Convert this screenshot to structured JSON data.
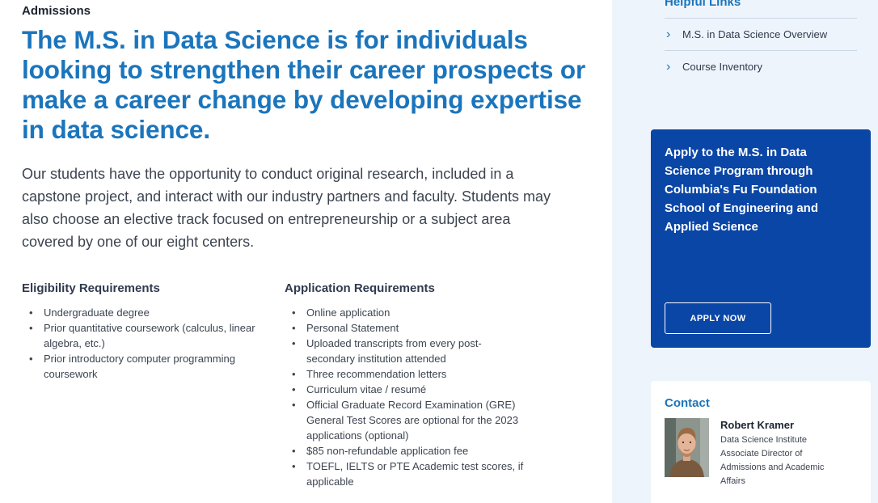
{
  "main": {
    "eyebrow": "Admissions",
    "headline": "The M.S. in Data Science is for individuals looking to strengthen their career prospects or make a career change by developing expertise in data science.",
    "intro": "Our students have the opportunity to conduct original research, included in a capstone project, and interact with our industry partners and faculty. Students may also choose an elective track focused on entrepreneurship or a subject area covered by one of our eight centers."
  },
  "eligibility": {
    "title": "Eligibility Requirements",
    "items": [
      "Undergraduate degree",
      "Prior quantitative coursework (calculus, linear algebra, etc.)",
      "Prior introductory computer programming coursework"
    ]
  },
  "application": {
    "title": "Application Requirements",
    "items": [
      "Online application",
      "Personal Statement",
      "Uploaded transcripts from every post-secondary institution attended",
      "Three recommendation letters",
      "Curriculum vitae / resumé",
      "Official Graduate Record Examination (GRE) General Test Scores are optional for the 2023 applications (optional)",
      "$85 non-refundable application fee",
      "TOEFL, IELTS or PTE Academic test scores, if applicable"
    ]
  },
  "sidebar": {
    "links_title": "Helpful Links",
    "links": [
      {
        "label": "M.S. in Data Science Overview",
        "icon": "chevron-right-icon"
      },
      {
        "label": "Course Inventory",
        "icon": "chevron-right-icon"
      }
    ],
    "apply": {
      "text": "Apply to the M.S. in Data Science Program through Columbia's Fu Foundation School of Engineering and Applied Science",
      "button": "APPLY NOW"
    },
    "contact": {
      "title": "Contact",
      "name": "Robert Kramer",
      "lines": [
        "Data Science Institute",
        "Associate Director of",
        "Admissions and Academic",
        "Affairs"
      ]
    }
  },
  "colors": {
    "accent": "#1b75bc",
    "apply_card": "#0a46a6",
    "sidebar_bg": "#eef4fb"
  }
}
